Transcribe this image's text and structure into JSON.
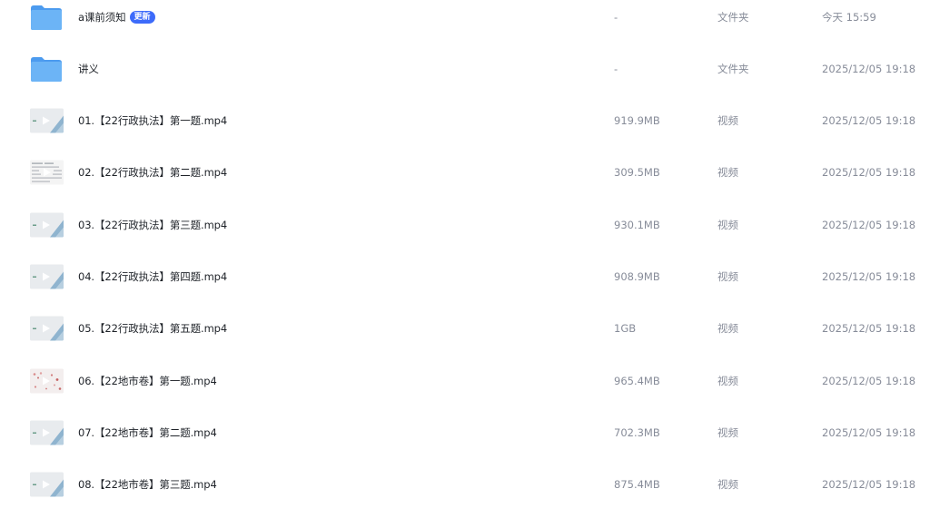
{
  "files": [
    {
      "name": "a课前须知",
      "badge": "更新",
      "size": "-",
      "type": "文件夹",
      "time": "今天 15:59",
      "kind": "folder"
    },
    {
      "name": "讲义",
      "size": "-",
      "type": "文件夹",
      "time": "2025/12/05 19:18",
      "kind": "folder"
    },
    {
      "name": "01.【22行政执法】第一题.mp4",
      "size": "919.9MB",
      "type": "视频",
      "time": "2025/12/05 19:18",
      "kind": "video"
    },
    {
      "name": "02.【22行政执法】第二题.mp4",
      "size": "309.5MB",
      "type": "视频",
      "time": "2025/12/05 19:18",
      "kind": "video-doc"
    },
    {
      "name": "03.【22行政执法】第三题.mp4",
      "size": "930.1MB",
      "type": "视频",
      "time": "2025/12/05 19:18",
      "kind": "video"
    },
    {
      "name": "04.【22行政执法】第四题.mp4",
      "size": "908.9MB",
      "type": "视频",
      "time": "2025/12/05 19:18",
      "kind": "video"
    },
    {
      "name": "05.【22行政执法】第五题.mp4",
      "size": "1GB",
      "type": "视频",
      "time": "2025/12/05 19:18",
      "kind": "video"
    },
    {
      "name": "06.【22地市卷】第一题.mp4",
      "size": "965.4MB",
      "type": "视频",
      "time": "2025/12/05 19:18",
      "kind": "video-pink"
    },
    {
      "name": "07.【22地市卷】第二题.mp4",
      "size": "702.3MB",
      "type": "视频",
      "time": "2025/12/05 19:18",
      "kind": "video"
    },
    {
      "name": "08.【22地市卷】第三题.mp4",
      "size": "875.4MB",
      "type": "视频",
      "time": "2025/12/05 19:18",
      "kind": "video"
    }
  ],
  "colors": {
    "accent": "#3d6bfa",
    "folder": "#5aa7f2",
    "text": "#1f2329",
    "muted": "#878c99"
  },
  "icons": {
    "folder": "folder-icon",
    "video": "video-thumbnail-icon",
    "play": "play-icon"
  }
}
